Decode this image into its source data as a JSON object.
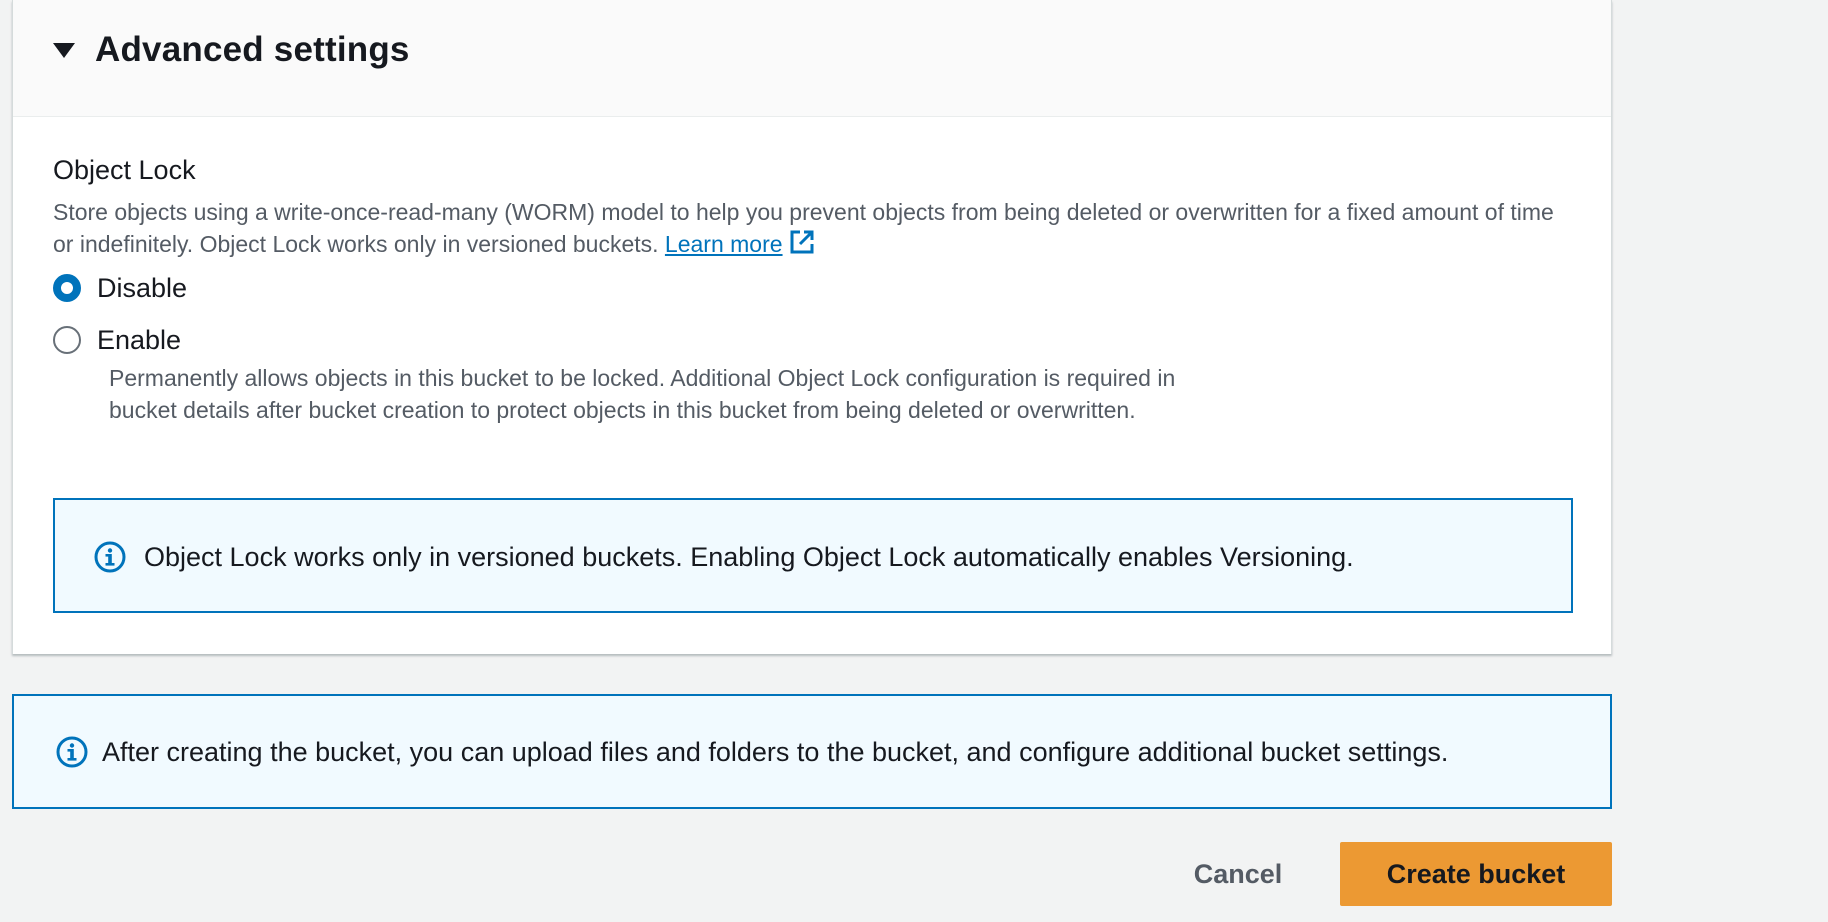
{
  "panel": {
    "title": "Advanced settings",
    "object_lock": {
      "label": "Object Lock",
      "description": "Store objects using a write-once-read-many (WORM) model to help you prevent objects from being deleted or overwritten for a fixed amount of time or indefinitely. Object Lock works only in versioned buckets.",
      "learn_more": "Learn more",
      "options": [
        {
          "label": "Disable",
          "checked": true
        },
        {
          "label": "Enable",
          "checked": false,
          "description": "Permanently allows objects in this bucket to be locked. Additional Object Lock configuration is required in bucket details after bucket creation to protect objects in this bucket from being deleted or overwritten."
        }
      ],
      "info_alert": "Object Lock works only in versioned buckets. Enabling Object Lock automatically enables Versioning."
    }
  },
  "footer_alert": "After creating the bucket, you can upload files and folders to the bucket, and configure additional bucket settings.",
  "actions": {
    "cancel": "Cancel",
    "create": "Create bucket"
  },
  "colors": {
    "link": "#0073bb",
    "primary_button": "#ec9933",
    "alert_bg": "#f1faff"
  }
}
